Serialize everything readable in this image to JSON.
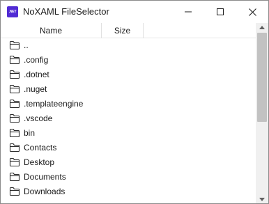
{
  "window": {
    "icon_text": ".NET",
    "title": "NoXAML FileSelector"
  },
  "columns": {
    "name": "Name",
    "size": "Size"
  },
  "items": [
    {
      "label": ".."
    },
    {
      "label": ".config"
    },
    {
      "label": ".dotnet"
    },
    {
      "label": ".nuget"
    },
    {
      "label": ".templateengine"
    },
    {
      "label": ".vscode"
    },
    {
      "label": "bin"
    },
    {
      "label": "Contacts"
    },
    {
      "label": "Desktop"
    },
    {
      "label": "Documents"
    },
    {
      "label": "Downloads"
    }
  ],
  "icons": {
    "item_icon": "folder-icon",
    "minimize": "minimize-icon",
    "maximize": "maximize-icon",
    "close": "close-icon"
  },
  "scrollbar": {
    "position_fraction": 0.0
  }
}
